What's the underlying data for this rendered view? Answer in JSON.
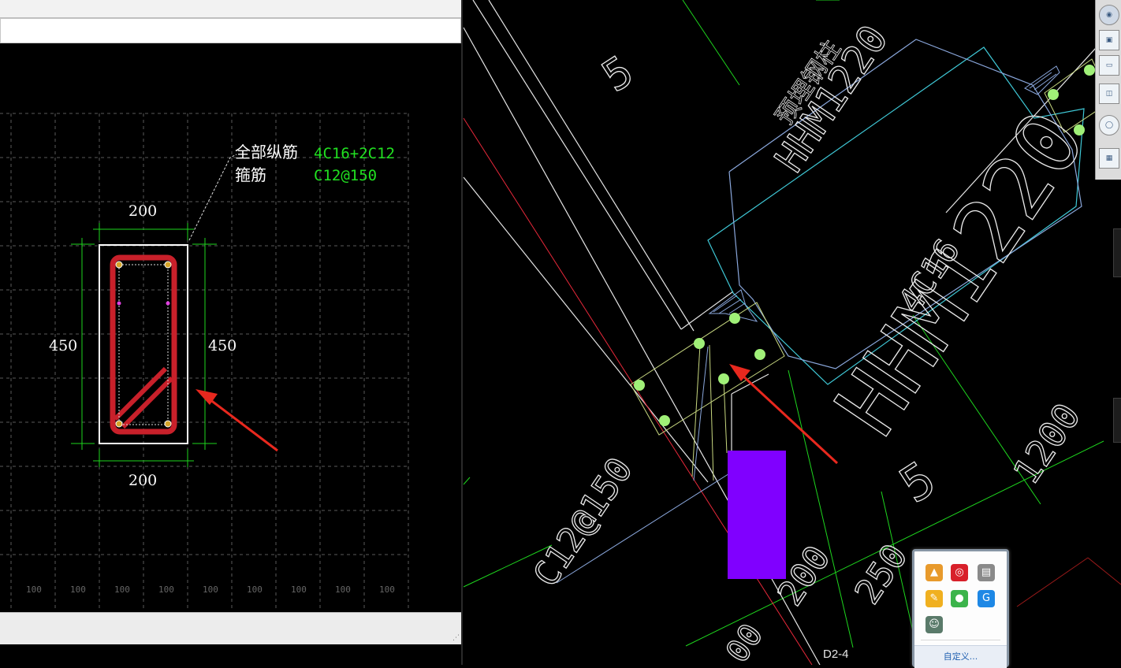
{
  "section_detail": {
    "longitudinal_label": "全部纵筋",
    "longitudinal_value": "4C16+2C12",
    "stirrup_label": "箍筋",
    "stirrup_value": "C12@150",
    "dim_top": "200",
    "dim_bottom": "200",
    "dim_left": "450",
    "dim_right": "450",
    "grid_labels": [
      "100",
      "100",
      "100",
      "100",
      "100",
      "100",
      "100",
      "100",
      "100"
    ]
  },
  "plan": {
    "axis_5_upper": "5",
    "steel_column_cn": "预埋钢柱",
    "steel_column_code": "HHM1220",
    "rebar_note": "4C16",
    "code_large": "HHM1220",
    "axis_5_lower": "5",
    "dim_1200": "1200",
    "stirrup_note": "C12@150",
    "dim_200": "200",
    "dim_250": "250",
    "dim_bottom_partial": "00",
    "tab_label": "D2-4"
  },
  "tray": {
    "customize_label": "自定义..."
  },
  "colors": {
    "rebar_red": "#c8202a",
    "dim_green": "#1ed61e",
    "text_green": "#21e021",
    "cyan_outline": "#3fc8d6",
    "blue_outline": "#8aa7dc",
    "purple_block": "#8000ff",
    "rebar_dot": "#a0f078",
    "arrow_red": "#e8281e"
  }
}
